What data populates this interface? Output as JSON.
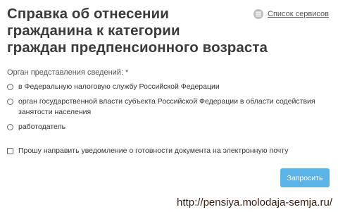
{
  "title_lines": [
    "Справка об отнесении",
    "гражданина к категории",
    "граждан предпенсионного возраста"
  ],
  "services_link": {
    "label": "Список сервисов",
    "icon": "list-icon"
  },
  "form": {
    "field_label": "Орган представления сведений:",
    "required_mark": "*",
    "options": [
      {
        "label": "в Федеральную налоговую службу Российской Федерации",
        "selected": false
      },
      {
        "label": "орган государственной власти субъекта Российской Федерации в области содействия занятости населения",
        "selected": false
      },
      {
        "label": "работодатель",
        "selected": false
      }
    ],
    "notify_checkbox": {
      "label": "Прошу направить уведомление о готовности документа на электронную почту",
      "checked": false
    },
    "submit_label": "Запросить"
  },
  "watermark": "http://pensiya.molodaja-semja.ru/",
  "colors": {
    "button": "#5ab4e6",
    "title": "#3b3b3b",
    "watermark": "#3a1f0f"
  }
}
